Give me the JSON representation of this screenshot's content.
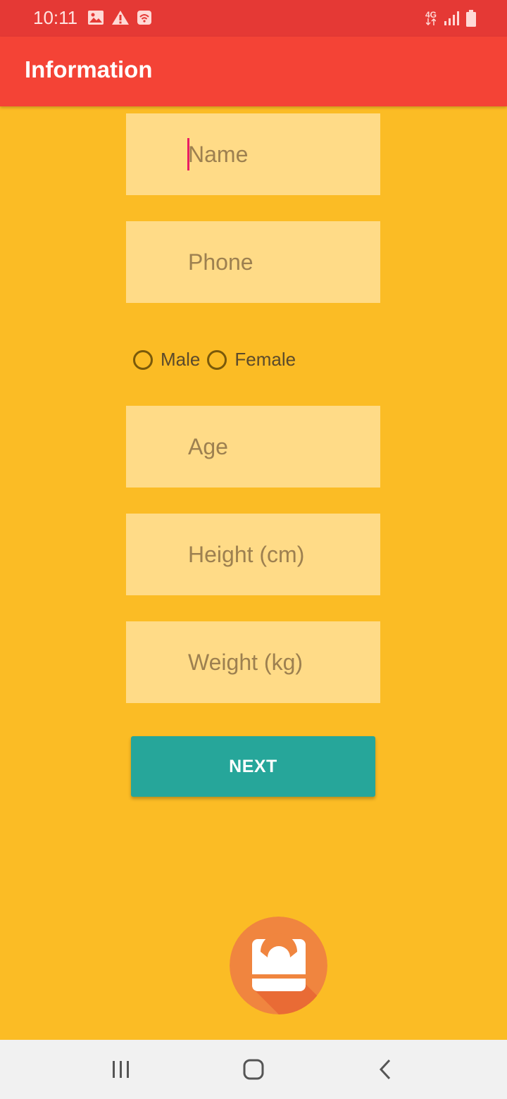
{
  "status_bar": {
    "time": "10:11",
    "network": "4G",
    "icons_left": [
      "image-icon",
      "warning-icon",
      "wifi-calling-icon"
    ],
    "icons_right": [
      "network-4g-icon",
      "signal-icon",
      "battery-icon"
    ]
  },
  "app_bar": {
    "title": "Information"
  },
  "form": {
    "name_placeholder": "Name",
    "phone_placeholder": "Phone",
    "gender_options": [
      "Male",
      "Female"
    ],
    "age_placeholder": "Age",
    "height_placeholder": "Height (cm)",
    "weight_placeholder": "Weight (kg)",
    "next_label": "NEXT"
  },
  "colors": {
    "status_bar": "#E53935",
    "app_bar": "#F44336",
    "background": "#FBBC25",
    "field": "#FFDB87",
    "button": "#26A69A",
    "logo": "#F0853F"
  },
  "logo": {
    "icon": "weight-scale-icon"
  },
  "nav_bar": {
    "buttons": [
      "recent-apps-icon",
      "home-icon",
      "back-icon"
    ]
  }
}
